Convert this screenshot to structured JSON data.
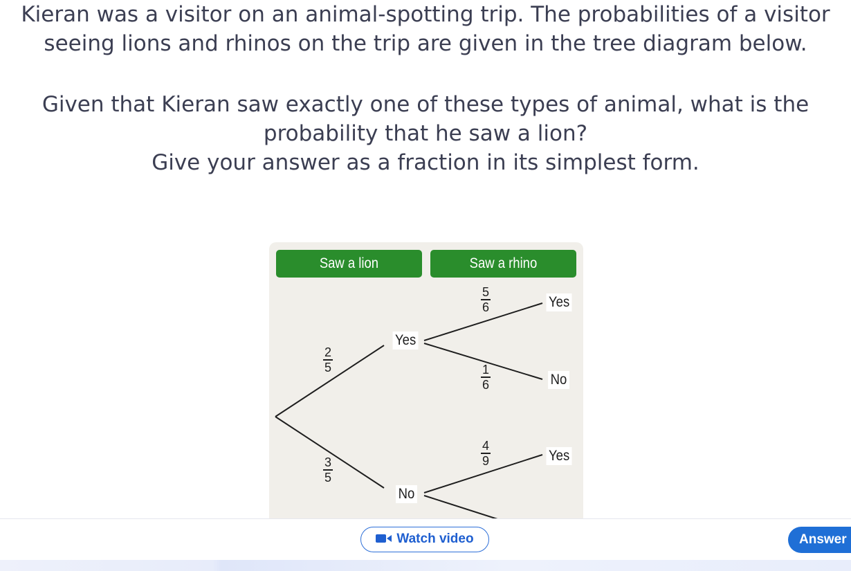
{
  "question": {
    "intro": "Kieran was a visitor on an animal-spotting trip. The probabilities of a visitor seeing lions and rhinos on the trip are given in the tree diagram below.",
    "ask_line1": "Given that Kieran saw exactly one of these types of animal, what is the probability that he saw a lion?",
    "ask_line2": "Give your answer as a fraction in its simplest form."
  },
  "diagram": {
    "header_lion": "Saw a lion",
    "header_rhino": "Saw a rhino",
    "lion_yes_label": "Yes",
    "lion_no_label": "No",
    "rhino_yes_1": "Yes",
    "rhino_no_1": "No",
    "rhino_yes_2": "Yes",
    "p_lion_yes": {
      "num": "2",
      "den": "5"
    },
    "p_lion_no": {
      "num": "3",
      "den": "5"
    },
    "p_rhino_yes_given_lion": {
      "num": "5",
      "den": "6"
    },
    "p_rhino_no_given_lion": {
      "num": "1",
      "den": "6"
    },
    "p_rhino_yes_given_no_lion": {
      "num": "4",
      "den": "9"
    },
    "colors": {
      "header": "#2a8d2c",
      "panel": "#f1efea"
    }
  },
  "actions": {
    "watch_video": "Watch video",
    "watch_video_icon": "video-camera-icon",
    "answer": "Answer",
    "accent": "#1f6fd6"
  }
}
